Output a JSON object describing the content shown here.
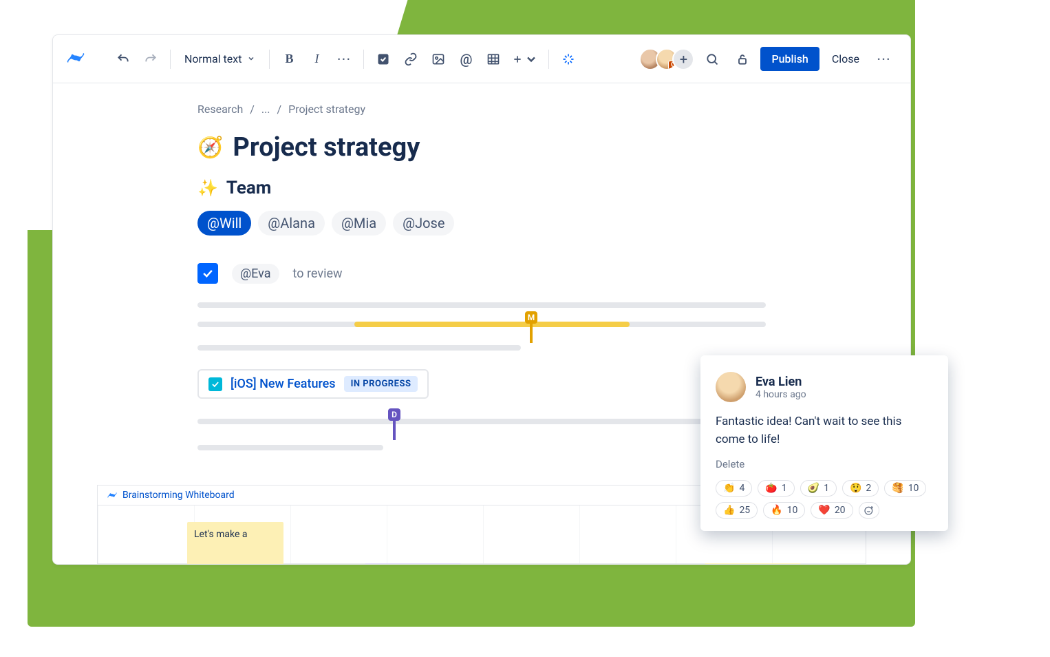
{
  "toolbar": {
    "text_style_label": "Normal text",
    "publish_label": "Publish",
    "close_label": "Close",
    "presence_badge": "C"
  },
  "breadcrumb": {
    "root": "Research",
    "mid": "...",
    "current": "Project strategy"
  },
  "page": {
    "title_icon": "🧭",
    "title": "Project strategy",
    "section_icon": "✨",
    "section_title": "Team"
  },
  "mentions": [
    "@Will",
    "@Alana",
    "@Mia",
    "@Jose"
  ],
  "task": {
    "mention": "@Eva",
    "label": "to review"
  },
  "markers": {
    "m": "M",
    "d": "D"
  },
  "issue": {
    "title": "[iOS] New Features",
    "status": "IN PROGRESS"
  },
  "whiteboard": {
    "title": "Brainstorming Whiteboard",
    "sticky1": "Let's make a"
  },
  "comment": {
    "name": "Eva Lien",
    "time": "4 hours ago",
    "body": "Fantastic idea! Can't wait to see this come to life!",
    "delete_label": "Delete",
    "reactions": [
      {
        "emoji": "👏",
        "count": "4"
      },
      {
        "emoji": "🍅",
        "count": "1"
      },
      {
        "emoji": "🥑",
        "count": "1"
      },
      {
        "emoji": "😲",
        "count": "2"
      },
      {
        "emoji": "🥞",
        "count": "10"
      },
      {
        "emoji": "👍",
        "count": "25"
      },
      {
        "emoji": "🔥",
        "count": "10"
      },
      {
        "emoji": "❤️",
        "count": "20"
      }
    ]
  }
}
